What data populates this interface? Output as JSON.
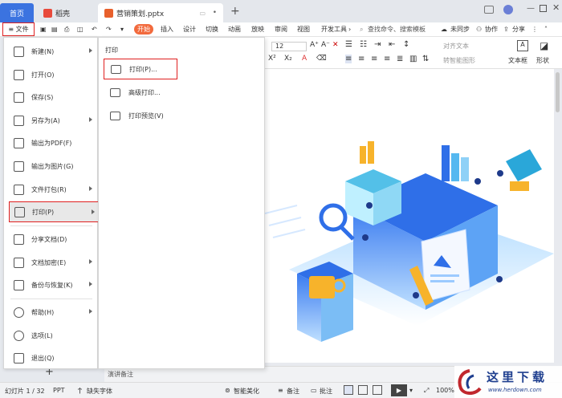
{
  "tabs": {
    "home": "首页",
    "docer": "稻壳",
    "document": "营销策划.pptx",
    "new_tab": "+"
  },
  "menubar": {
    "file": "≡ 文件",
    "start": "开始",
    "items": [
      "插入",
      "设计",
      "切换",
      "动画",
      "放映",
      "审阅",
      "视图",
      "开发工具"
    ],
    "search": "查找命令、搜索模板",
    "sync": "未同步",
    "collab": "协作",
    "share": "分享"
  },
  "toolbar": {
    "font_size": "12",
    "align_text": "对齐文本",
    "smart_art": "转智能图形",
    "textbox": "文本框",
    "shape": "形状"
  },
  "file_menu": {
    "items": [
      {
        "label": "新建(N)",
        "arrow": true
      },
      {
        "label": "打开(O)",
        "arrow": false
      },
      {
        "label": "保存(S)",
        "arrow": false
      },
      {
        "label": "另存为(A)",
        "arrow": true
      },
      {
        "label": "输出为PDF(F)",
        "arrow": false
      },
      {
        "label": "输出为图片(G)",
        "arrow": false
      },
      {
        "label": "文件打包(R)",
        "arrow": true
      },
      {
        "label": "打印(P)",
        "arrow": true
      },
      {
        "label": "分享文档(D)",
        "arrow": false
      },
      {
        "label": "文档加密(E)",
        "arrow": true
      },
      {
        "label": "备份与恢复(K)",
        "arrow": true
      },
      {
        "label": "帮助(H)",
        "arrow": true
      },
      {
        "label": "选项(L)",
        "arrow": false
      },
      {
        "label": "退出(Q)",
        "arrow": false
      }
    ]
  },
  "print_submenu": {
    "title": "打印",
    "items": [
      "打印(P)...",
      "高级打印...",
      "打印预览(V)"
    ]
  },
  "notes": "演讲备注",
  "status": {
    "slide": "幻灯片 1 / 32",
    "type": "PPT",
    "missing_font": "缺失字体",
    "smart_beautify": "智能美化",
    "notes_btn": "备注",
    "comments": "批注",
    "zoom": "100%"
  },
  "watermark": {
    "title": "这里下载",
    "url": "www.herdown.com"
  },
  "colors": {
    "accent_blue": "#3b73e0",
    "start_orange": "#f26a3d",
    "highlight_red": "#e02020"
  }
}
